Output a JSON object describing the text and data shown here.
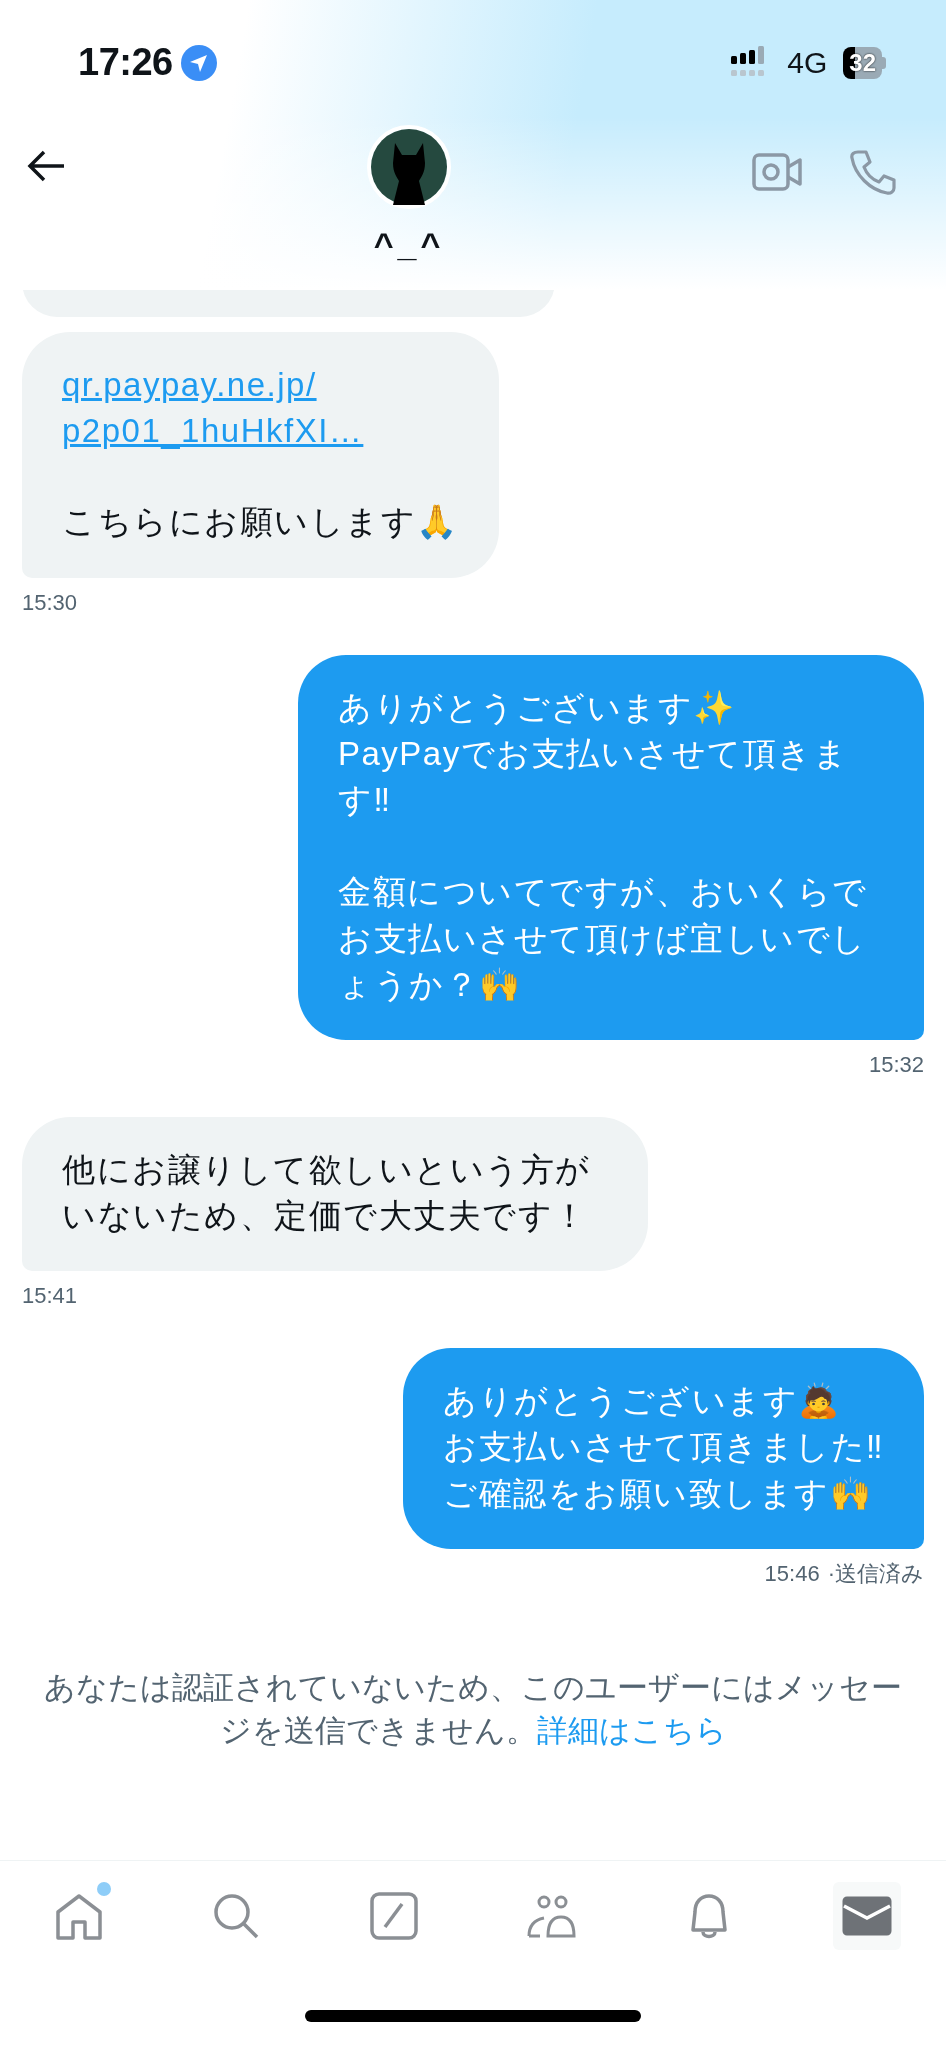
{
  "status_bar": {
    "time": "17:26",
    "network": "4G",
    "battery": "32"
  },
  "header": {
    "name": "^_^"
  },
  "messages": [
    {
      "kind": "partial"
    },
    {
      "kind": "received",
      "link": "qr.paypay.ne.jp/\np2p01_1huHkfXI…",
      "text": "こちらにお願いします🙏",
      "time": "15:30"
    },
    {
      "kind": "sent",
      "text": "ありがとうございます✨\nPayPayでお支払いさせて頂きます‼\n\n金額についてですが、おいくらでお支払いさせて頂けば宜しいでしょうか？🙌",
      "time": "15:32"
    },
    {
      "kind": "received",
      "text": "他にお譲りして欲しいという方がいないため、定価で大丈夫です！",
      "time": "15:41"
    },
    {
      "kind": "sent",
      "text": "ありがとうございます🙇\nお支払いさせて頂きました‼\nご確認をお願い致します🙌",
      "time": "15:46",
      "status": "·送信済み"
    }
  ],
  "notice": {
    "text": "あなたは認証されていないため、このユーザーにはメッセージを送信できません。",
    "link": "詳細はこちら"
  },
  "nav": [
    {
      "kind": "home",
      "selected": false,
      "badge": true
    },
    {
      "kind": "search",
      "selected": false,
      "badge": false
    },
    {
      "kind": "compose",
      "selected": false,
      "badge": false
    },
    {
      "kind": "communities",
      "selected": false,
      "badge": false
    },
    {
      "kind": "notifications",
      "selected": false,
      "badge": false
    },
    {
      "kind": "messages",
      "selected": true,
      "badge": false
    }
  ]
}
